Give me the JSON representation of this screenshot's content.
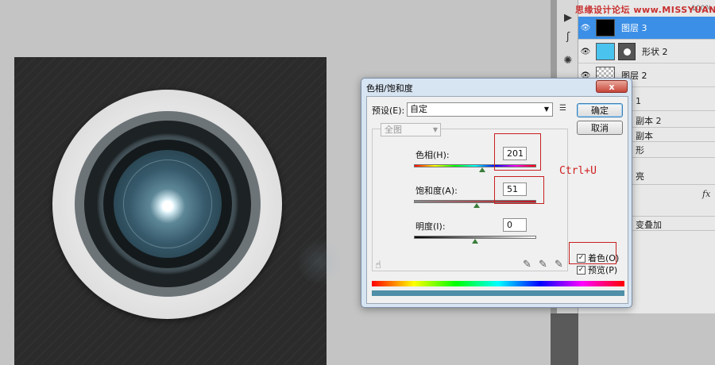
{
  "watermark": "思缘设计论坛 www.MISSYUAN.COM",
  "layers_panel": {
    "zoom_percent": "100%",
    "layers": [
      {
        "name": "图层 3",
        "thumb": "black",
        "selected": true
      },
      {
        "name": "形状 2",
        "thumb": "cyan",
        "mask": true
      },
      {
        "name": "图层 2",
        "thumb": "checker"
      }
    ],
    "partial_rows": [
      "1",
      "副本 2",
      "副本",
      "形",
      "亮",
      "变叠加"
    ],
    "fx_label": "fx"
  },
  "dialog": {
    "title": "色相/饱和度",
    "close_label": "x",
    "preset_label": "预设(E):",
    "preset_value": "自定",
    "ok_label": "确定",
    "cancel_label": "取消",
    "channel_value": "全图",
    "hue": {
      "label": "色相(H):",
      "value": "201",
      "position": 0.56
    },
    "saturation": {
      "label": "饱和度(A):",
      "value": "51",
      "position": 0.51
    },
    "lightness": {
      "label": "明度(I):",
      "value": "0",
      "position": 0.5
    },
    "colorize": {
      "label": "着色(O)",
      "checked": true
    },
    "preview": {
      "label": "预览(P)",
      "checked": true
    }
  },
  "annotation": "Ctrl+U",
  "colors": {
    "selection_blue": "#3b8fe6",
    "annotation_red": "#d02020",
    "tint_bar": "#4f8fa8"
  }
}
